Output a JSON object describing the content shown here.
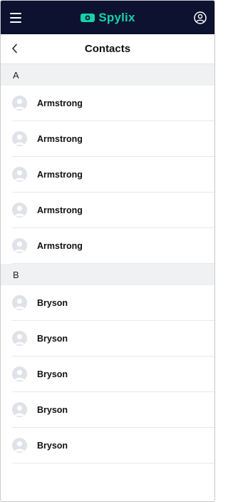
{
  "app": {
    "brand_name": "Spylix",
    "brand_color": "#17d1a8",
    "topbar_color": "#0c1230"
  },
  "icons": {
    "menu": "hamburger-menu-icon",
    "profile": "user-circle-icon",
    "back": "chevron-left-icon",
    "avatar": "person-avatar-icon"
  },
  "header": {
    "title": "Contacts"
  },
  "sections": [
    {
      "letter": "A",
      "contacts": [
        "Armstrong",
        "Armstrong",
        "Armstrong",
        "Armstrong",
        "Armstrong"
      ]
    },
    {
      "letter": "B",
      "contacts": [
        "Bryson",
        "Bryson",
        "Bryson",
        "Bryson",
        "Bryson"
      ]
    }
  ]
}
